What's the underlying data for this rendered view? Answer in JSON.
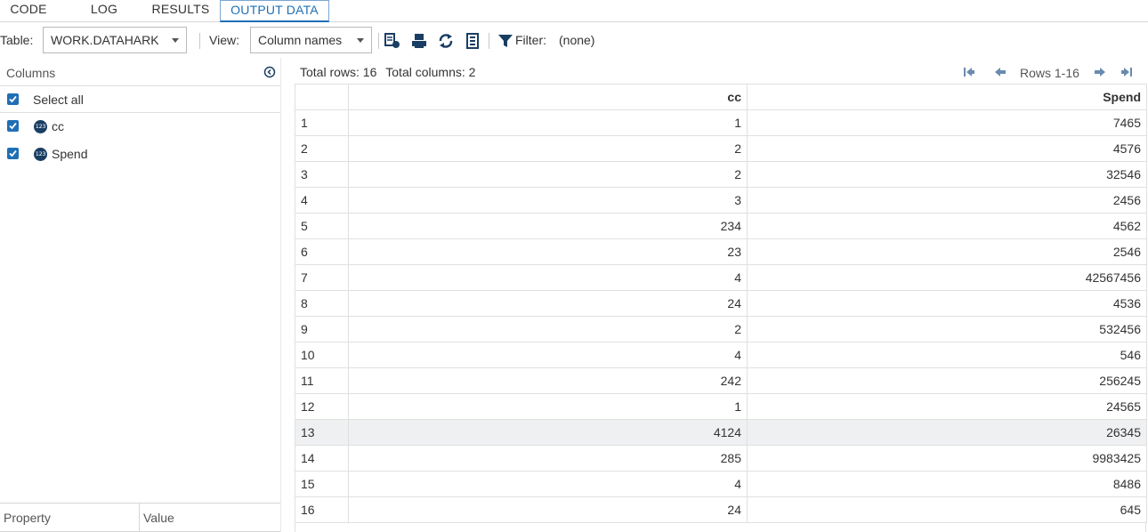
{
  "tabs": [
    "CODE",
    "LOG",
    "RESULTS",
    "OUTPUT DATA"
  ],
  "active_tab": "OUTPUT DATA",
  "toolbar": {
    "table_label": "Table:",
    "table_value": "WORK.DATAHARK",
    "view_label": "View:",
    "view_value": "Column names",
    "filter_label": "Filter:",
    "filter_value": "(none)",
    "icons": [
      "data-properties-icon",
      "print-icon",
      "refresh-icon",
      "column-list-icon",
      "filter-icon"
    ]
  },
  "columns_panel": {
    "title": "Columns",
    "select_all_label": "Select all",
    "items": [
      {
        "name": "cc",
        "type_badge": "123",
        "checked": true
      },
      {
        "name": "Spend",
        "type_badge": "123",
        "checked": true
      }
    ]
  },
  "property_panel": {
    "headers": [
      "Property",
      "Value"
    ]
  },
  "summary": {
    "total_rows": "Total rows: 16",
    "total_columns": "Total columns: 2"
  },
  "pager": {
    "rows_text": "Rows 1-16"
  },
  "grid": {
    "headers": [
      "",
      "cc",
      "Spend"
    ],
    "highlight_row": 13,
    "rows": [
      [
        "1",
        "1",
        "7465"
      ],
      [
        "2",
        "2",
        "4576"
      ],
      [
        "3",
        "2",
        "32546"
      ],
      [
        "4",
        "3",
        "2456"
      ],
      [
        "5",
        "234",
        "4562"
      ],
      [
        "6",
        "23",
        "2546"
      ],
      [
        "7",
        "4",
        "42567456"
      ],
      [
        "8",
        "24",
        "4536"
      ],
      [
        "9",
        "2",
        "532456"
      ],
      [
        "10",
        "4",
        "546"
      ],
      [
        "11",
        "242",
        "256245"
      ],
      [
        "12",
        "1",
        "24565"
      ],
      [
        "13",
        "4124",
        "26345"
      ],
      [
        "14",
        "285",
        "9983425"
      ],
      [
        "15",
        "4",
        "8486"
      ],
      [
        "16",
        "24",
        "645"
      ]
    ]
  },
  "colors": {
    "accent": "#1f6fb5",
    "badge": "#1a3e63",
    "icon": "#1a3e63",
    "highlight_row": "#eef0f2"
  }
}
